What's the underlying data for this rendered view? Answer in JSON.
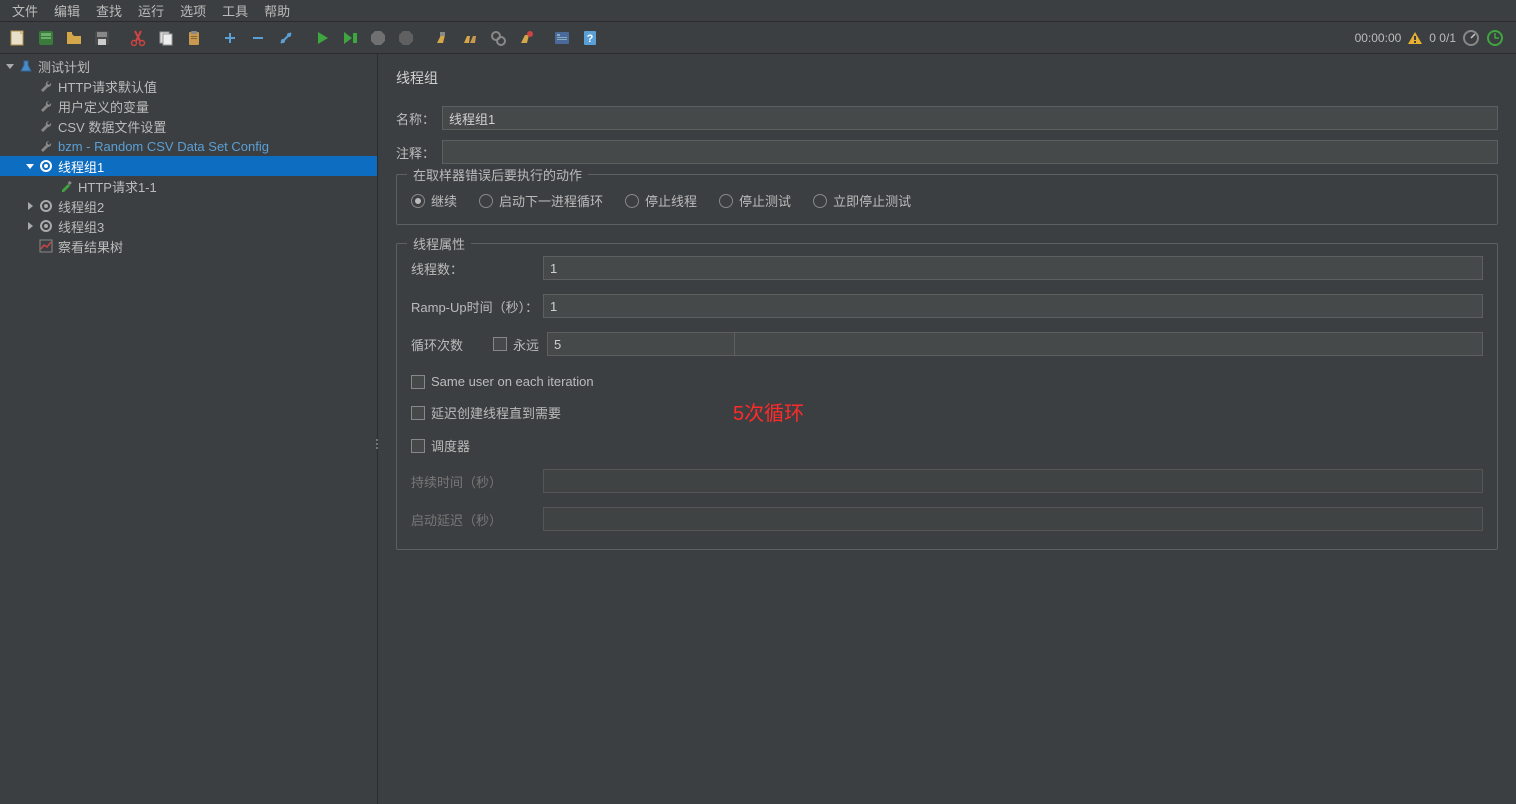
{
  "menu": [
    "文件",
    "编辑",
    "查找",
    "运行",
    "选项",
    "工具",
    "帮助"
  ],
  "status": {
    "time": "00:00:00",
    "counts": "0  0/1"
  },
  "tree": [
    {
      "indent": 0,
      "arrow": "down",
      "icon": "flask",
      "label": "测试计划",
      "blue": false,
      "sel": false
    },
    {
      "indent": 1,
      "arrow": "",
      "icon": "wrench",
      "label": "HTTP请求默认值",
      "blue": false,
      "sel": false
    },
    {
      "indent": 1,
      "arrow": "",
      "icon": "wrench",
      "label": "用户定义的变量",
      "blue": false,
      "sel": false
    },
    {
      "indent": 1,
      "arrow": "",
      "icon": "wrench",
      "label": "CSV 数据文件设置",
      "blue": false,
      "sel": false
    },
    {
      "indent": 1,
      "arrow": "",
      "icon": "wrench",
      "label": "bzm - Random CSV Data Set Config",
      "blue": true,
      "sel": false
    },
    {
      "indent": 1,
      "arrow": "down",
      "icon": "gear",
      "label": "线程组1",
      "blue": false,
      "sel": true
    },
    {
      "indent": 2,
      "arrow": "",
      "icon": "dropper",
      "label": "HTTP请求1-1",
      "blue": false,
      "sel": false
    },
    {
      "indent": 1,
      "arrow": "right",
      "icon": "gear",
      "label": "线程组2",
      "blue": false,
      "sel": false
    },
    {
      "indent": 1,
      "arrow": "right",
      "icon": "gear",
      "label": "线程组3",
      "blue": false,
      "sel": false
    },
    {
      "indent": 1,
      "arrow": "",
      "icon": "chart",
      "label": "察看结果树",
      "blue": false,
      "sel": false
    }
  ],
  "panel": {
    "title": "线程组",
    "name_label": "名称：",
    "name_value": "线程组1",
    "comment_label": "注释：",
    "comment_value": "",
    "error_legend": "在取样器错误后要执行的动作",
    "radios": [
      {
        "label": "继续",
        "checked": true
      },
      {
        "label": "启动下一进程循环",
        "checked": false
      },
      {
        "label": "停止线程",
        "checked": false
      },
      {
        "label": "停止测试",
        "checked": false
      },
      {
        "label": "立即停止测试",
        "checked": false
      }
    ],
    "props_legend": "线程属性",
    "threads_label": "线程数：",
    "threads_value": "1",
    "rampup_label": "Ramp-Up时间（秒）：",
    "rampup_value": "1",
    "loop_label": "循环次数",
    "forever_label": "永远",
    "loop_value": "5",
    "cb_sameuser": "Same user on each iteration",
    "cb_delay": "延迟创建线程直到需要",
    "cb_sched": "调度器",
    "duration_label": "持续时间（秒）",
    "startup_label": "启动延迟（秒）",
    "annotation": "5次循环"
  }
}
